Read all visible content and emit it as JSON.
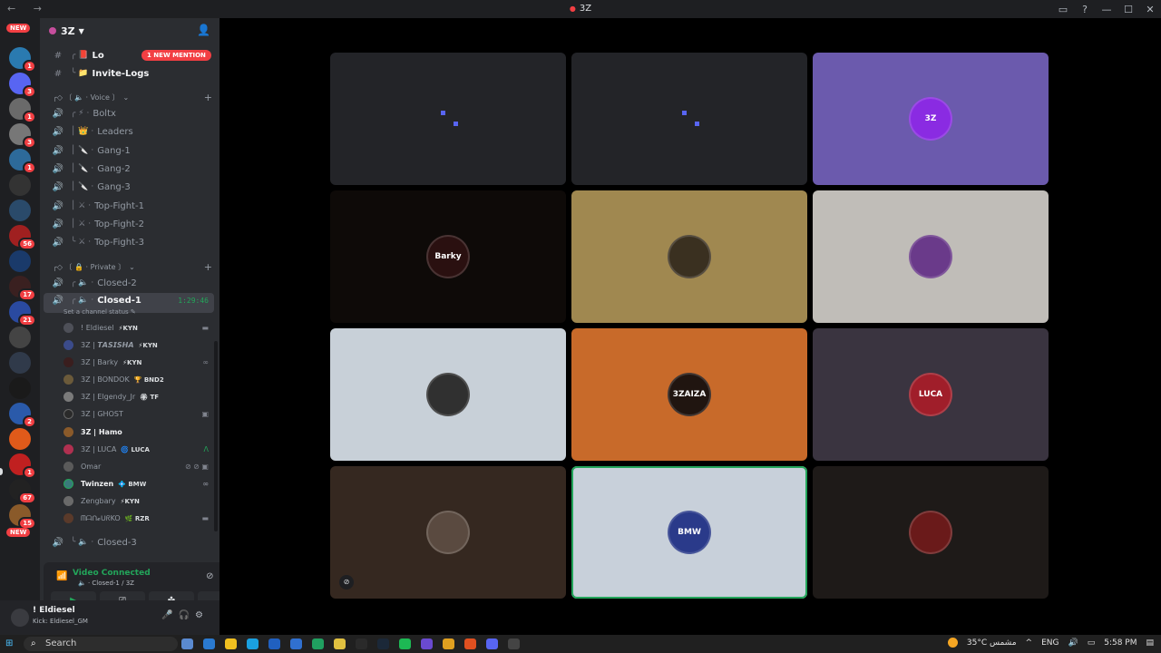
{
  "window": {
    "title": "3Z",
    "nav": "← →"
  },
  "window_controls": {
    "inbox": "▭",
    "help": "?",
    "min": "—",
    "max": "☐",
    "close": "✕"
  },
  "rail": {
    "new_top": "NEW",
    "new_bottom": "NEW",
    "badges": [
      "1",
      "3",
      "1",
      "3",
      "1",
      "56",
      "17",
      "21",
      "1",
      "2",
      "1",
      "67",
      "15"
    ]
  },
  "server": {
    "name": "3Z",
    "invite_icon": "person-add-icon"
  },
  "mention_pill": "1 NEW MENTION",
  "channels_text": [
    {
      "name": "Lo",
      "prefix": "╭ 📕"
    },
    {
      "name": "Invite-Logs",
      "prefix": "╰ 📁"
    }
  ],
  "category_voice": "╭◇ 〔 🔈 · Voice 〕",
  "channels_voice": [
    {
      "name": "Boltx",
      "prefix": "╭ ⚡ ·"
    },
    {
      "name": "Leaders",
      "prefix": "│ 👑 ·"
    },
    {
      "name": "Gang-1",
      "prefix": "│ 🔪 ·"
    },
    {
      "name": "Gang-2",
      "prefix": "│ 🔪 ·"
    },
    {
      "name": "Gang-3",
      "prefix": "│ 🔪 ·"
    },
    {
      "name": "Top-Fight-1",
      "prefix": "│ ⚔ ·"
    },
    {
      "name": "Top-Fight-2",
      "prefix": "│ ⚔ ·"
    },
    {
      "name": "Top-Fight-3",
      "prefix": "╰ ⚔ ·"
    }
  ],
  "category_private": "╭◇ 〔 🔒 · Private 〕",
  "channels_private": [
    {
      "name": "Closed-2",
      "prefix": "╭ 🔈 ·"
    },
    {
      "name": "Closed-1",
      "prefix": "╭ 🔈 ·",
      "timer": "1:29:46"
    }
  ],
  "channel_status": "Set a channel status ✎",
  "members": [
    {
      "name": "! Eldiesel",
      "tag": "⚡KYN",
      "color": "#4e5058",
      "icon": "▬"
    },
    {
      "name": "3Z | 𝙏𝘼𝙎𝙄𝙎𝙃𝘼",
      "tag": "⚡KYN",
      "color": "#3b4b8a",
      "icon": ""
    },
    {
      "name": "3Z | Barky",
      "tag": "⚡KYN",
      "color": "#3a1e1e",
      "icon": "∞"
    },
    {
      "name": "3Z | BONDOK",
      "tag": "🏆 BND2",
      "color": "#6b5a3a",
      "icon": ""
    },
    {
      "name": "3Z | Elgendy_Jr",
      "tag": "🏵 TF",
      "color": "#7a7a7a",
      "icon": ""
    },
    {
      "name": "3Z | GHOST",
      "tag": "",
      "color": "#2a2a2a",
      "icon": "▣"
    },
    {
      "name": "3Z | Hamo",
      "tag": "",
      "color": "#8a5a2a",
      "icon": ""
    },
    {
      "name": "3Z | LUCA",
      "tag": "🌀 LUCA",
      "color": "#b03050",
      "icon": "Λ"
    },
    {
      "name": "Omar",
      "tag": "",
      "color": "#5a5a5a",
      "icon": "⊘ ⊘ ▣"
    },
    {
      "name": "Twinzen",
      "tag": "💠 BMW",
      "color": "#3a7a7a",
      "icon": "∞"
    },
    {
      "name": "Zengbary",
      "tag": "⚡KYN",
      "color": "#6a6a6a",
      "icon": ""
    },
    {
      "name": "ᗰᗩᑎ𝓸ᑌᖇKO",
      "tag": "🌿 RZR",
      "color": "#5a3a2a",
      "icon": "▬"
    }
  ],
  "channel_closed3": {
    "name": "Closed-3",
    "prefix": "╰ 🔈 ·"
  },
  "voice": {
    "title": "Video Connected",
    "subtitle": "🔈 · Closed-1 / 3Z",
    "buttons": [
      "camera-icon",
      "screen-share-icon",
      "activities-icon",
      "soundboard-icon"
    ]
  },
  "user": {
    "name": "! Eldiesel",
    "status": "Kick: Eldiesel_GM"
  },
  "tiles": [
    {
      "bg": "#232428",
      "kind": "squares"
    },
    {
      "bg": "#232428",
      "kind": "squares"
    },
    {
      "bg": "#6b5aad",
      "av": "#8a2be2",
      "avtext": "3Z"
    },
    {
      "bg": "#0e0a08",
      "av": "#2a1010",
      "avtext": "Barky"
    },
    {
      "bg": "#a08850",
      "av": "#3a3020",
      "avtext": ""
    },
    {
      "bg": "#c0bdb8",
      "av": "#6a3a8a",
      "avtext": ""
    },
    {
      "bg": "#c8d0d8",
      "av": "#303030",
      "avtext": ""
    },
    {
      "bg": "#c86a2a",
      "av": "#201510",
      "avtext": "3ZAIZA"
    },
    {
      "bg": "#3a3440",
      "av": "#a01e2a",
      "avtext": "LUCA"
    },
    {
      "bg": "#352820",
      "av": "#5a4a40",
      "avtext": ""
    },
    {
      "bg": "#c8d0da",
      "av": "#2a3a8a",
      "avtext": "BMW",
      "selected": true
    },
    {
      "bg": "#1e1a18",
      "av": "#6a1a1a",
      "avtext": ""
    }
  ],
  "taskbar": {
    "search": "Search",
    "weather": "35°C مشمس",
    "lang": "ENG",
    "time": "5:58 PM"
  }
}
